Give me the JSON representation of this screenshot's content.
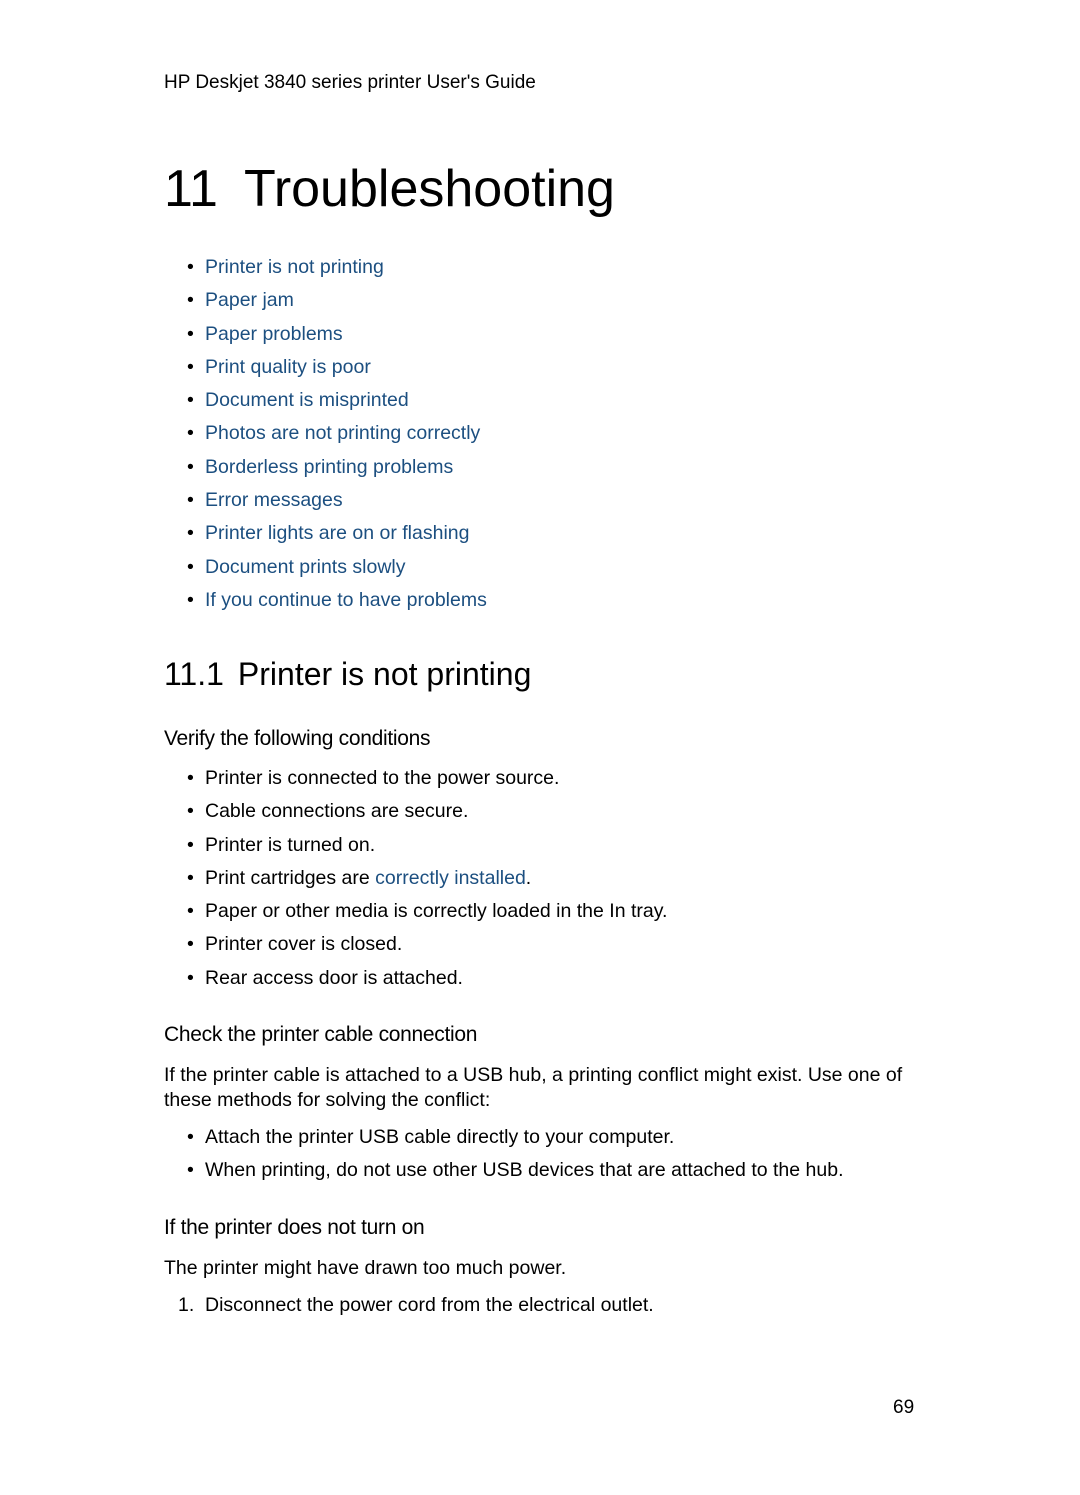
{
  "header": {
    "running_title": "HP Deskjet 3840 series printer User's Guide"
  },
  "chapter": {
    "number": "11",
    "title": "Troubleshooting"
  },
  "toc": [
    "Printer is not printing",
    "Paper jam",
    "Paper problems",
    "Print quality is poor",
    "Document is misprinted",
    "Photos are not printing correctly",
    "Borderless printing problems",
    "Error messages",
    "Printer lights are on or flashing",
    "Document prints slowly",
    "If you continue to have problems"
  ],
  "section": {
    "number": "11.1",
    "title": "Printer is not printing"
  },
  "verify": {
    "heading": "Verify the following conditions",
    "items": [
      "Printer is connected to the power source.",
      "Cable connections are secure.",
      "Printer is turned on.",
      {
        "before": "Print cartridges are ",
        "link": "correctly installed",
        "after": "."
      },
      "Paper or other media is correctly loaded in the In tray.",
      "Printer cover is closed.",
      "Rear access door is attached."
    ]
  },
  "cable": {
    "heading": "Check the printer cable connection",
    "paragraph": "If the printer cable is attached to a USB hub, a printing conflict might exist. Use one of these methods for solving the conflict:",
    "items": [
      "Attach the printer USB cable directly to your computer.",
      "When printing, do not use other USB devices that are attached to the hub."
    ]
  },
  "power": {
    "heading": "If the printer does not turn on",
    "paragraph": "The printer might have drawn too much power.",
    "steps": [
      {
        "num": "1.",
        "text": "Disconnect the power cord from the electrical outlet."
      }
    ]
  },
  "page_number": "69",
  "colors": {
    "link": "#1c4f80",
    "text": "#000000"
  },
  "bullet_glyph": "•"
}
